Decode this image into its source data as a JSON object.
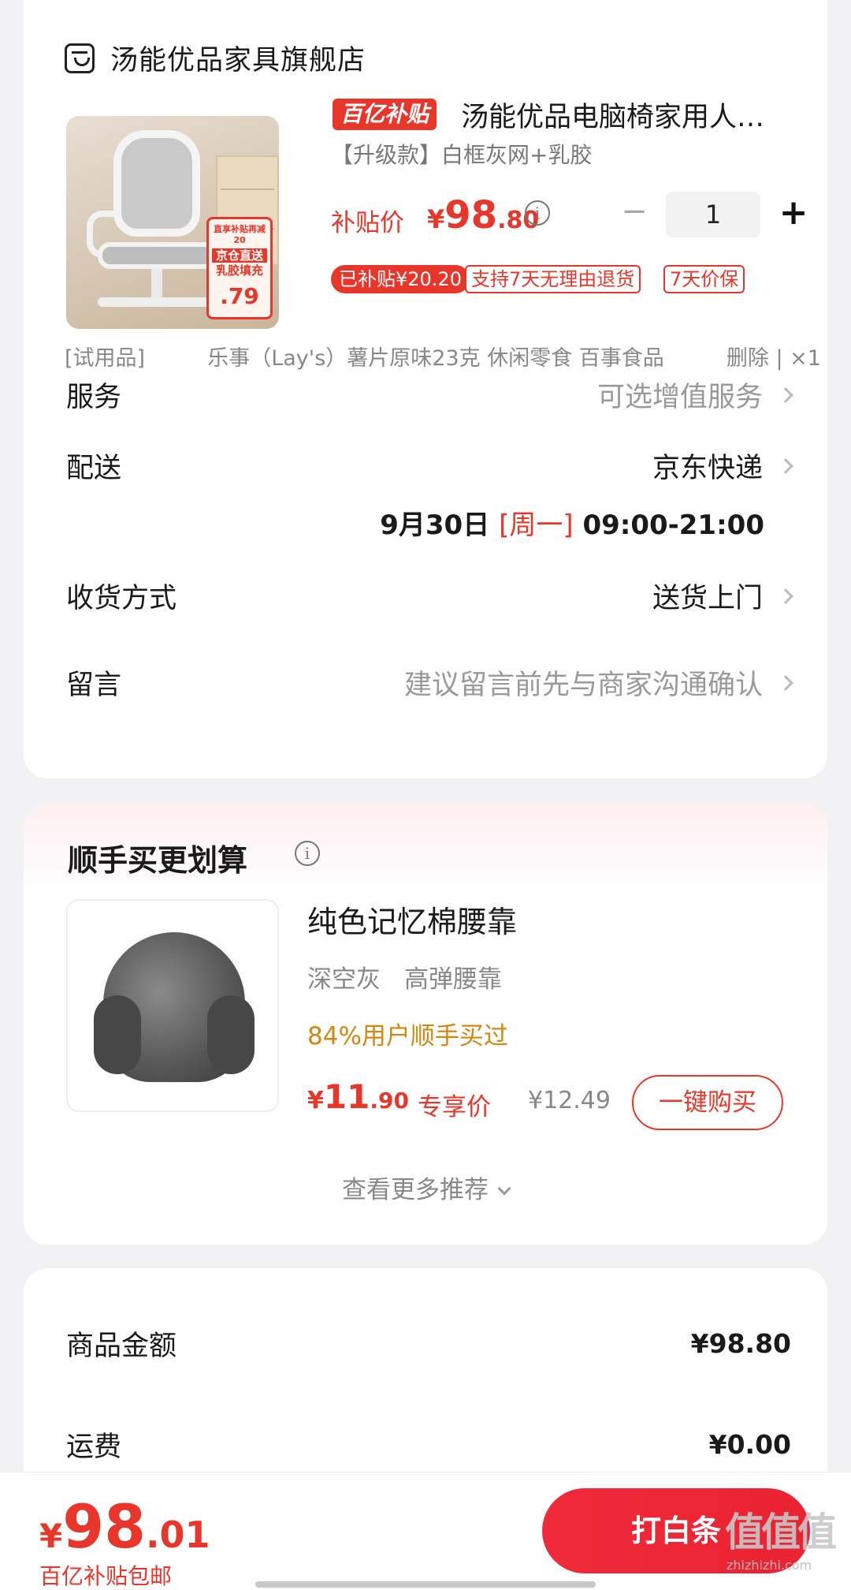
{
  "store": {
    "name": "汤能优品家具旗舰店",
    "icon": "store-icon"
  },
  "product": {
    "promo_badge": "百亿补贴",
    "title": "汤能优品电脑椅家用人…",
    "spec": "【升级款】白框灰网+乳胶",
    "price_label": "补贴价",
    "price_currency": "¥",
    "price_int": "98",
    "price_dec": ".80",
    "info_symbol": "i",
    "qty_minus": "−",
    "quantity": "1",
    "qty_plus": "+",
    "tags": [
      "已补贴¥20.20",
      "支持7天无理由退货",
      "7天价保"
    ],
    "image_sticker": {
      "line1": "直享补贴再减20",
      "line2": "京仓直送",
      "line3": "乳胶填充",
      "price": ".79"
    }
  },
  "trial": {
    "tag": "[试用品]",
    "name": "乐事（Lay's）薯片原味23克  休闲零食 百事食品",
    "action": "删除 | ×1"
  },
  "options": {
    "service": {
      "label": "服务",
      "value": "可选增值服务"
    },
    "delivery": {
      "label": "配送",
      "value": "京东快递",
      "date": "9月30日",
      "weekday": "[周一]",
      "time": "09:00-21:00"
    },
    "receive": {
      "label": "收货方式",
      "value": "送货上门"
    },
    "message": {
      "label": "留言",
      "placeholder": "建议留言前先与商家沟通确认"
    }
  },
  "addon": {
    "title": "顺手买更划算",
    "name": "纯色记忆棉腰靠",
    "specs": [
      "深空灰",
      "高弹腰靠"
    ],
    "popularity": "84%用户顺手买过",
    "price_currency": "¥",
    "price_int": "11",
    "price_dec": ".90",
    "exclusive_label": "专享价",
    "original_price": "¥12.49",
    "buy_label": "一键购买",
    "more_label": "查看更多推荐"
  },
  "summary": {
    "goods_label": "商品金额",
    "goods_value": "¥98.80",
    "shipping_label": "运费",
    "shipping_value": "¥0.00"
  },
  "footer": {
    "total_currency": "¥",
    "total_int": "98",
    "total_dec": ".01",
    "note": "百亿补贴包邮",
    "pay_label": "打白条",
    "watermark": "值值值",
    "watermark_sub": "zhizhizhi.com"
  },
  "colors": {
    "accent": "#e8372a",
    "popularity": "#d4870f",
    "background": "#f2f2f4"
  }
}
